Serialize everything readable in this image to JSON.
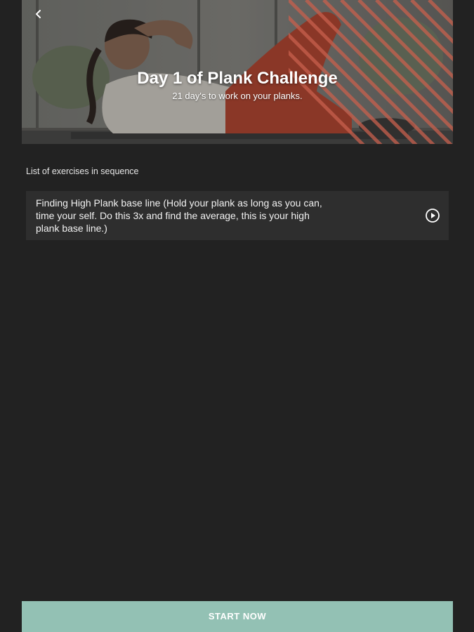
{
  "hero": {
    "back_icon": "chevron-left-icon",
    "title": "Day 1 of Plank Challenge",
    "subtitle": "21 day's to work on your planks."
  },
  "exercises": {
    "section_label": "List of exercises in sequence",
    "items": [
      {
        "text": "Finding High Plank base line (Hold your plank as long as you can, time your self. Do this 3x and find the average, this is your high plank base line.)",
        "icon": "play-circle-icon"
      }
    ]
  },
  "footer": {
    "start_label": "START NOW"
  },
  "colors": {
    "background": "#222222",
    "card": "#2e2e2e",
    "accent": "#93c1b4",
    "stripes": "#c8604d"
  }
}
